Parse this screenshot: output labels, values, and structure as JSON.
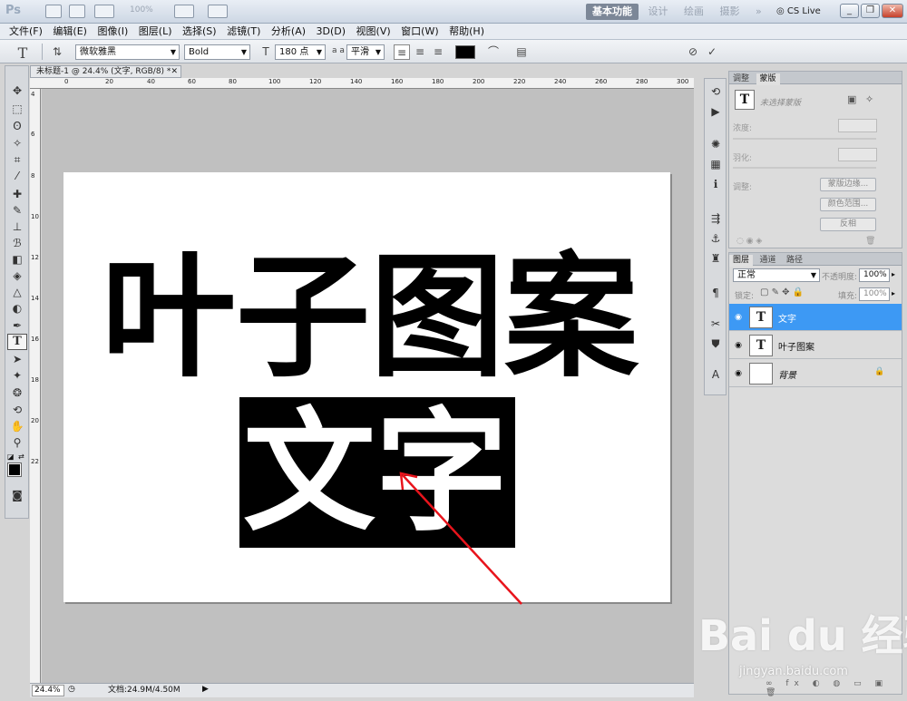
{
  "app": {
    "logo": "Ps",
    "zoom_preset": "100%"
  },
  "workspace": {
    "tabs": [
      "基本功能",
      "设计",
      "绘画",
      "摄影"
    ],
    "active": "基本功能",
    "more": "»",
    "cs_live": "CS Live"
  },
  "window_controls": {
    "minimize": "_",
    "restore": "❐",
    "close": "✕"
  },
  "menu": {
    "items": [
      "文件(F)",
      "编辑(E)",
      "图像(I)",
      "图层(L)",
      "选择(S)",
      "滤镜(T)",
      "分析(A)",
      "3D(D)",
      "视图(V)",
      "窗口(W)",
      "帮助(H)"
    ]
  },
  "options": {
    "tool_glyph": "T",
    "font_family": "微软雅黑",
    "font_style": "Bold",
    "font_size": "180 点",
    "aa_label": "a a",
    "antialias": "平滑",
    "color": "#000000"
  },
  "document": {
    "tab_title": "未标题-1 @ 24.4% (文字, RGB/8) *",
    "headline": "叶子图案",
    "selected_word": "文字",
    "zoom": "24.4%",
    "doc_info": "文档:24.9M/4.50M",
    "ruler_h": [
      "0",
      "20",
      "40",
      "60",
      "80",
      "100",
      "120",
      "140",
      "160",
      "180",
      "200",
      "220",
      "240",
      "260",
      "280",
      "300"
    ],
    "ruler_v": [
      "4",
      "6",
      "8",
      "10",
      "12",
      "14",
      "16",
      "18",
      "20",
      "22"
    ]
  },
  "mask_panel": {
    "tabs": [
      "调整",
      "蒙版"
    ],
    "active_tab": "蒙版",
    "status": "未选择蒙版",
    "density_label": "浓度:",
    "feather_label": "羽化:",
    "refine_label": "调整:",
    "btn_mask_edge": "蒙版边缘...",
    "btn_color_range": "颜色范围...",
    "btn_invert": "反相"
  },
  "layers_panel": {
    "tabs": [
      "图层",
      "通道",
      "路径"
    ],
    "active_tab": "图层",
    "blend_mode": "正常",
    "opacity_label": "不透明度:",
    "opacity": "100%",
    "lock_label": "锁定:",
    "fill_label": "填充:",
    "fill": "100%",
    "layers": [
      {
        "name": "文字",
        "thumb": "T",
        "selected": true
      },
      {
        "name": "叶子图案",
        "thumb": "T",
        "selected": false
      },
      {
        "name": "背景",
        "thumb": "",
        "selected": false
      }
    ]
  },
  "watermark": {
    "logo": "Bai du 经验",
    "url": "jingyan.baidu.com"
  },
  "colors": {
    "selection": "#3d99f4",
    "annotation_arrow": "#e8141c",
    "canvas_bg": "#c0c0c0"
  }
}
